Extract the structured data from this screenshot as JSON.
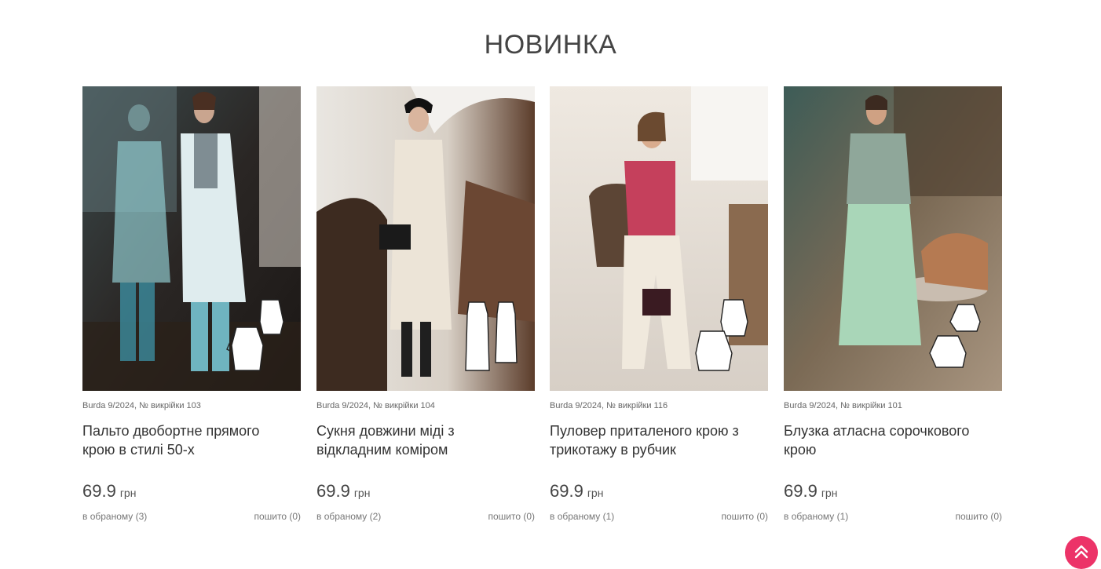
{
  "section": {
    "title": "НОВИНКА"
  },
  "products": [
    {
      "meta": "Burda 9/2024, № викрійки 103",
      "title": "Пальто двобортне прямого крою в стилі 50-х",
      "price": "69.9",
      "currency": "грн",
      "favorites": "в обраному (3)",
      "sewn": "пошито (0)",
      "image_icon": "coat-photo"
    },
    {
      "meta": "Burda 9/2024, № викрійки 104",
      "title": "Сукня довжини міді з відкладним коміром",
      "price": "69.9",
      "currency": "грн",
      "favorites": "в обраному (2)",
      "sewn": "пошито (0)",
      "image_icon": "dress-photo"
    },
    {
      "meta": "Burda 9/2024, № викрійки 116",
      "title": "Пуловер приталеного крою з трикотажу в рубчик",
      "price": "69.9",
      "currency": "грн",
      "favorites": "в обраному (1)",
      "sewn": "пошито (0)",
      "image_icon": "pullover-photo"
    },
    {
      "meta": "Burda 9/2024, № викрійки 101",
      "title": "Блузка атласна сорочкового крою",
      "price": "69.9",
      "currency": "грн",
      "favorites": "в обраному (1)",
      "sewn": "пошито (0)",
      "image_icon": "blouse-photo"
    }
  ],
  "scroll_top": {
    "icon": "double-chevron-up-icon",
    "color": "#ec3368"
  }
}
